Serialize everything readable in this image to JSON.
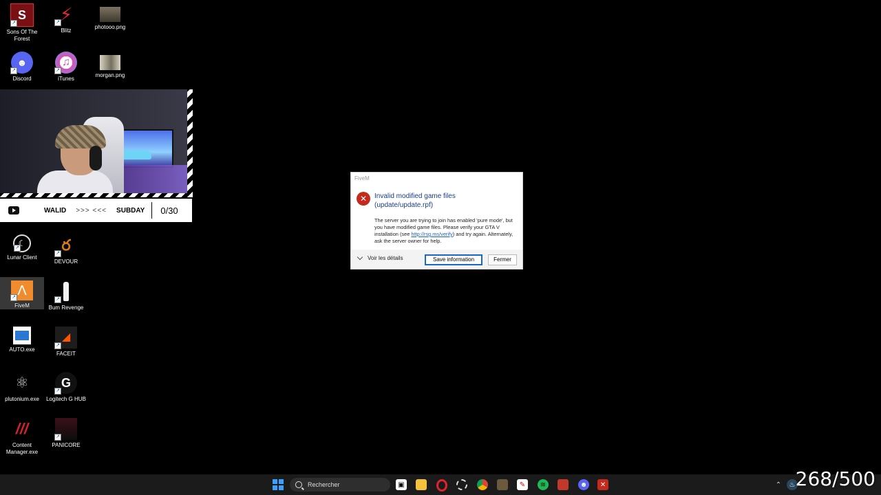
{
  "desktop": {
    "icons": [
      {
        "label": "Sons Of The Forest"
      },
      {
        "label": "Blitz"
      },
      {
        "label": "photooo.png"
      },
      {
        "label": "Discord"
      },
      {
        "label": "iTunes"
      },
      {
        "label": "morgan.png"
      },
      {
        "label": "Lunar Client"
      },
      {
        "label": "DEVOUR"
      },
      {
        "label": "FiveM"
      },
      {
        "label": "Bum Revenge"
      },
      {
        "label": "AUTO.exe"
      },
      {
        "label": "FACEIT"
      },
      {
        "label": "plutonium.exe"
      },
      {
        "label": "Logitech G HUB"
      },
      {
        "label": "Content Manager.exe"
      },
      {
        "label": "PANICORE"
      }
    ]
  },
  "stream_overlay": {
    "player1": "WALID",
    "arrows": ">>> <<<",
    "player2": "SUBDAY",
    "score": "0/30"
  },
  "dialog": {
    "app_title": "FiveM",
    "headline": "Invalid modified game files (update/update.rpf)",
    "body_before_link": "The server you are trying to join has enabled 'pure mode', but you have modified game files. Please verify your GTA V installation (see ",
    "link": "http://rsg.ms/verify",
    "body_after_link": ") and try again. Alternately, ask the server owner for help.",
    "details_label": "Voir les détails",
    "save_button": "Save information",
    "close_button": "Fermer"
  },
  "taskbar": {
    "search_placeholder": "Rechercher"
  },
  "overlay_counter": "268/500"
}
